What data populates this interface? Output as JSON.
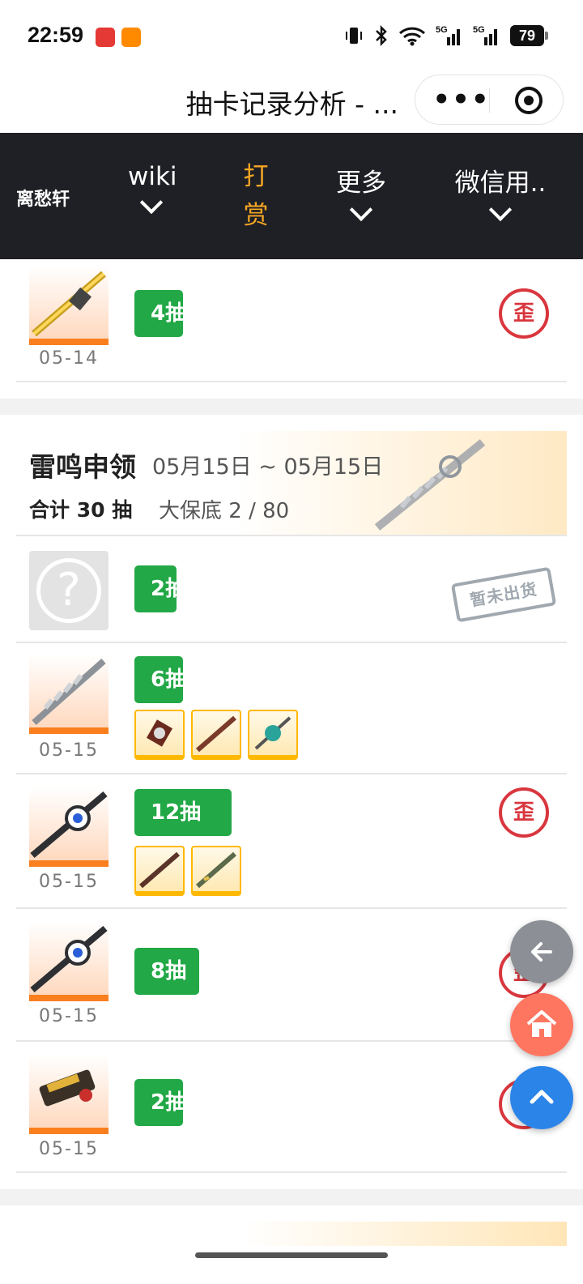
{
  "status": {
    "time": "22:59",
    "battery": "79"
  },
  "title": {
    "text": "抽卡记录分析 - ...",
    "menu_dots": "•••"
  },
  "nav": {
    "brand": "离愁轩",
    "items": [
      {
        "label": "wiki"
      },
      {
        "label": "打赏"
      },
      {
        "label": "更多"
      },
      {
        "label": "微信用.."
      }
    ]
  },
  "top_record": {
    "pulls": "4抽",
    "date": "05-14",
    "badge": "歪"
  },
  "banner": {
    "name": "雷鸣申领",
    "range": "05月15日 ~ 05月15日",
    "total": "合计 30 抽",
    "pity": "大保底 2 / 80"
  },
  "records": [
    {
      "pulls": "2抽",
      "date": "",
      "status": "暂未出货",
      "badge": ""
    },
    {
      "pulls": "6抽",
      "date": "05-15",
      "badge": ""
    },
    {
      "pulls": "12抽",
      "date": "05-15",
      "badge": "歪"
    },
    {
      "pulls": "8抽",
      "date": "05-15",
      "badge": "歪"
    },
    {
      "pulls": "2抽",
      "date": "05-15",
      "badge": "歪"
    }
  ],
  "fabs": {
    "back": "arrow-left-icon",
    "home": "home-icon",
    "top": "chevron-up-icon"
  },
  "colors": {
    "pill_green": "#22a846",
    "badge_red": "#d9363e",
    "nav_bg": "#1f2025",
    "nav_active": "#f5a623",
    "accent_orange": "#fa7f1f"
  }
}
